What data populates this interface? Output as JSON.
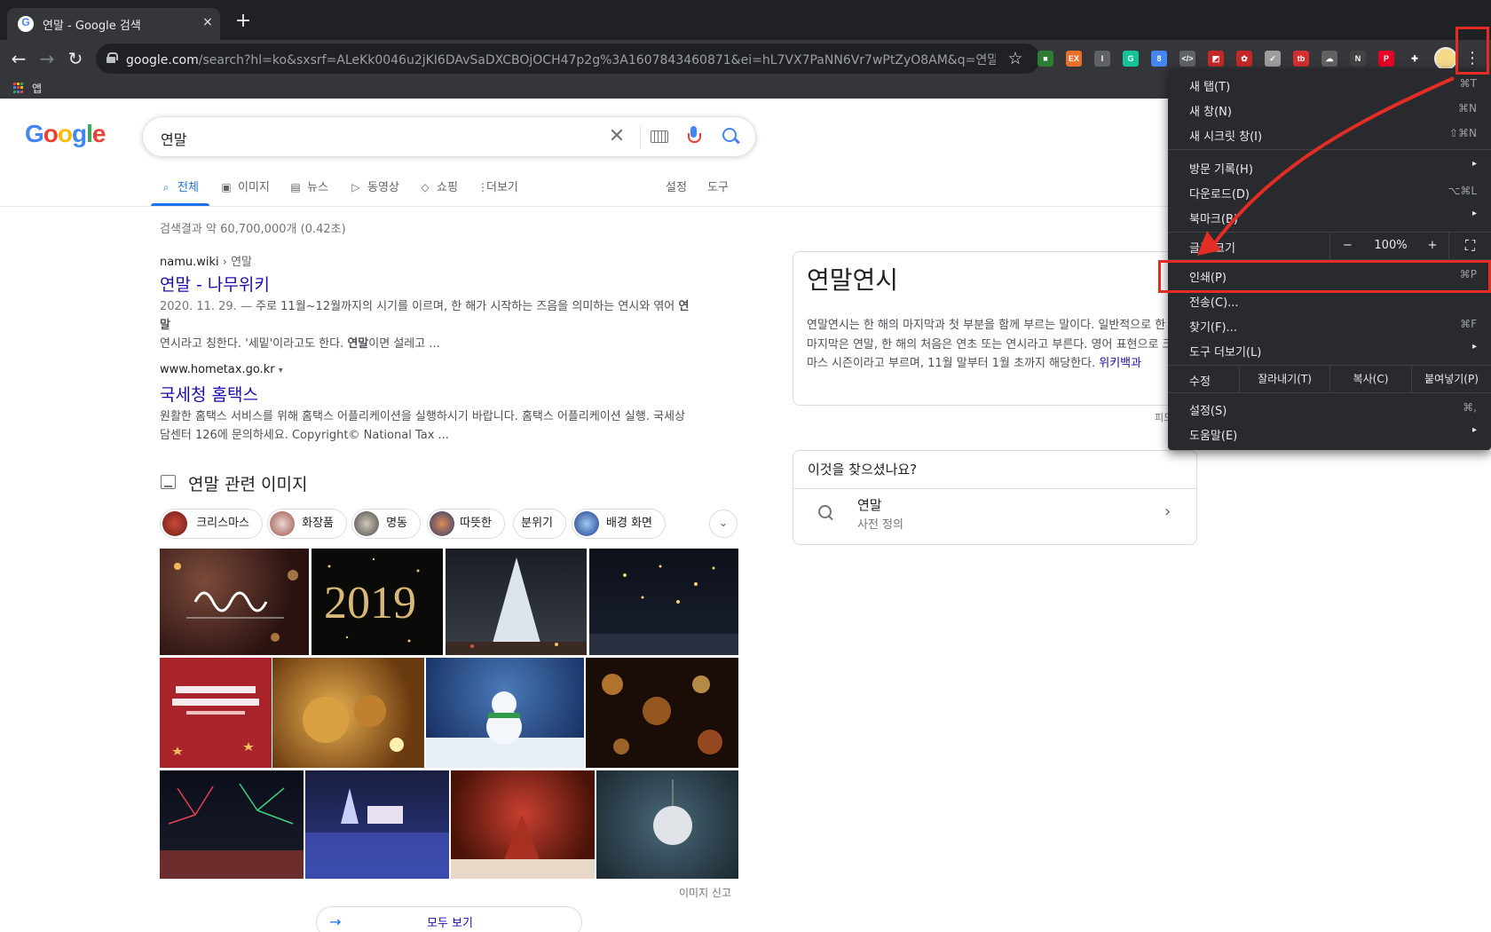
{
  "browser": {
    "tab_title": "연말 - Google 검색",
    "tab_close": "×",
    "new_tab": "+",
    "url_host": "google.com",
    "url_path": "/search?hl=ko&sxsrf=ALeKk0046u2jKI6DAvSaDXCBOjOCH47p2g%3A1607843460871&ei=hL7VX7PaNN6Vr7wPtZyO8AM&q=연말&oq...",
    "back": "←",
    "forward": "→",
    "reload": "↻",
    "star": "☆",
    "kebab": "⋮",
    "apps_label": "앱",
    "extensions": [
      {
        "icon": "extension-green-icon",
        "color": "#2e7d32",
        "text": "■"
      },
      {
        "icon": "extension-ex-icon",
        "color": "#e8702a",
        "text": "EX"
      },
      {
        "icon": "extension-i-icon",
        "color": "#5f6368",
        "text": "I"
      },
      {
        "icon": "grammarly-icon",
        "color": "#15c39a",
        "text": "G"
      },
      {
        "icon": "extension-blue-icon",
        "color": "#4285f4",
        "text": "8"
      },
      {
        "icon": "code-icon",
        "color": "#5f6368",
        "text": "</>"
      },
      {
        "icon": "extension-flag-icon",
        "color": "#c62828",
        "text": "◩"
      },
      {
        "icon": "extension-red-icon",
        "color": "#c62828",
        "text": "✿"
      },
      {
        "icon": "extension-check-icon",
        "color": "#9e9e9e",
        "text": "✓"
      },
      {
        "icon": "extension-tb-icon",
        "color": "#d32f2f",
        "text": "tb"
      },
      {
        "icon": "extension-cloud-icon",
        "color": "#616161",
        "text": "☁"
      },
      {
        "icon": "extension-n-icon",
        "color": "#424242",
        "text": "N"
      },
      {
        "icon": "pinterest-icon",
        "color": "#e60023",
        "text": "P"
      },
      {
        "icon": "puzzle-icon",
        "color": "#35363a",
        "text": "✚"
      }
    ]
  },
  "google": {
    "logo": [
      "G",
      "o",
      "o",
      "g",
      "l",
      "e"
    ],
    "query": "연말",
    "clear": "✕",
    "tabs": [
      {
        "icon": "search-icon",
        "glyph": "🔍",
        "label": "전체"
      },
      {
        "icon": "image-icon",
        "glyph": "▣",
        "label": "이미지"
      },
      {
        "icon": "news-icon",
        "glyph": "▤",
        "label": "뉴스"
      },
      {
        "icon": "video-icon",
        "glyph": "▷",
        "label": "동영상"
      },
      {
        "icon": "tag-icon",
        "glyph": "◇",
        "label": "쇼핑"
      },
      {
        "icon": "more-icon",
        "glyph": "⋮",
        "label": "더보기"
      }
    ],
    "settings": "설정",
    "tools": "도구",
    "stats": "검색결과 약 60,700,000개 (0.42초)",
    "results": [
      {
        "cite_host": "namu.wiki",
        "cite_crumb": " › 연말",
        "title": "연말 - 나무위키",
        "date": "2020. 11. 29. — ",
        "snippet_1": "주로 11월~12월까지의 시기를 이르며, 한 해가 시작하는 즈음을 의미하는 연시와 엮어 ",
        "snippet_bold_1": "연말",
        "snippet_2": "연시라고 칭한다. '세밑'이라고도 한다. ",
        "snippet_bold_2": "연말",
        "snippet_3": "이면 설레고 ..."
      },
      {
        "cite_host": "www.hometax.go.kr",
        "cite_drop": "▾",
        "title": "국세청 홈택스",
        "snippet": "원활한 홈택스 서비스를 위해 홈택스 어플리케이션을 실행하시기 바랍니다. 홈택스 어플리케이션 실행. 국세상담센터 126에 문의하세요. Copyright© National Tax ..."
      }
    ],
    "images_header": "연말 관련 이미지",
    "chips": [
      "크리스마스",
      "화장품",
      "명동",
      "따뜻한",
      "분위기",
      "배경 화면"
    ],
    "chip_more": "⌄",
    "image_report": "이미지 신고",
    "see_all": "모두 보기",
    "see_all_arrow": "→"
  },
  "knowledge_panel": {
    "title": "연말연시",
    "description": "연말연시는 한 해의 마지막과 첫 부분을 함께 부르는 말이다. 일반적으로 한 해의 마지막은 연말, 한 해의 처음은 연초 또는 연시라고 부른다. 영어 표현으로 크리스마스 시즌이라고 부르며, 11월 말부터 1월 초까지 해당한다. ",
    "source_link": "위키백과",
    "feedback": "피드"
  },
  "did_you_mean": {
    "title": "이것을 찾으셨나요?",
    "term": "연말",
    "subtitle": "사전 정의",
    "chevron": "›"
  },
  "menu": {
    "items_top": [
      {
        "label": "새 탭(T)",
        "shortcut": "⌘T"
      },
      {
        "label": "새 창(N)",
        "shortcut": "⌘N"
      },
      {
        "label": "새 시크릿 창(I)",
        "shortcut": "⇧⌘N"
      }
    ],
    "history": "방문 기록(H)",
    "downloads": "다운로드(D)",
    "downloads_shortcut": "⌥⌘L",
    "bookmarks": "북마크(B)",
    "zoom_label": "글꼴 크기",
    "zoom_minus": "−",
    "zoom_value": "100%",
    "zoom_plus": "+",
    "fullscreen": "⛶",
    "print": "인쇄(P)",
    "print_shortcut": "⌘P",
    "cast": "전송(C)...",
    "find": "찾기(F)...",
    "find_shortcut": "⌘F",
    "more_tools": "도구 더보기(L)",
    "edit_label": "수정",
    "cut": "잘라내기(T)",
    "copy": "복사(C)",
    "paste": "붙여넣기(P)",
    "settings": "설정(S)",
    "settings_shortcut": "⌘,",
    "help": "도움말(E)",
    "submenu_arrow": "▸"
  }
}
